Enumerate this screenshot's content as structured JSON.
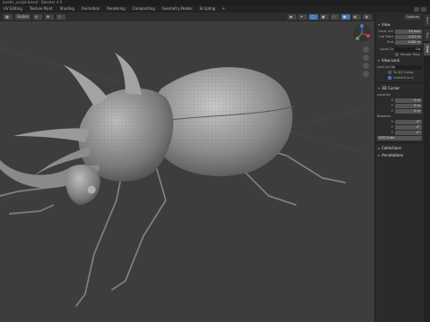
{
  "title": "beetle_sculpt.blend - Blender 4.0",
  "tabs": [
    {
      "label": "UV Editing",
      "active": false
    },
    {
      "label": "Texture Paint",
      "active": false
    },
    {
      "label": "Shading",
      "active": false
    },
    {
      "label": "Animation",
      "active": false
    },
    {
      "label": "Rendering",
      "active": false
    },
    {
      "label": "Compositing",
      "active": false
    },
    {
      "label": "Geometry Nodes",
      "active": false
    },
    {
      "label": "Scripting",
      "active": false
    }
  ],
  "add_tab": "+",
  "header": {
    "view_mode": "Global",
    "options": "Options"
  },
  "n_tabs": [
    "Item",
    "Tool",
    "View"
  ],
  "npanel": {
    "view_section": "View",
    "focal_length": {
      "label": "Focal Len",
      "value": "50 mm"
    },
    "clip_start": {
      "label": "Clip Start",
      "value": "0.01 m"
    },
    "clip_end": {
      "label": "End",
      "value": "1000 m"
    },
    "local_camera": {
      "label": "Local Ca",
      "value": "Ca"
    },
    "render_region": "Render Regi",
    "view_lock": "View Lock",
    "lock_object": {
      "label": "Lock to Obj",
      "value": ""
    },
    "lock_3d_cursor": "To 3D Cursor",
    "lock_camera": "Camera to V",
    "cursor_section": "3D Cursor",
    "location_label": "Location",
    "cursor_loc": [
      {
        "axis": "X",
        "value": "0 m"
      },
      {
        "axis": "Y",
        "value": "0 m"
      },
      {
        "axis": "Z",
        "value": "0 m"
      }
    ],
    "rotation_label": "Rotation",
    "cursor_rot": [
      {
        "axis": "X",
        "value": "0°"
      },
      {
        "axis": "Y",
        "value": "0°"
      },
      {
        "axis": "Z",
        "value": "0°"
      }
    ],
    "rot_mode": "XYZ Euler",
    "collections": "Collections",
    "annotations": "Annotations"
  },
  "colors": {
    "viewport_bg": "#3d3d3d",
    "mesh": "#9a9a9a",
    "accent": "#4772b3"
  }
}
